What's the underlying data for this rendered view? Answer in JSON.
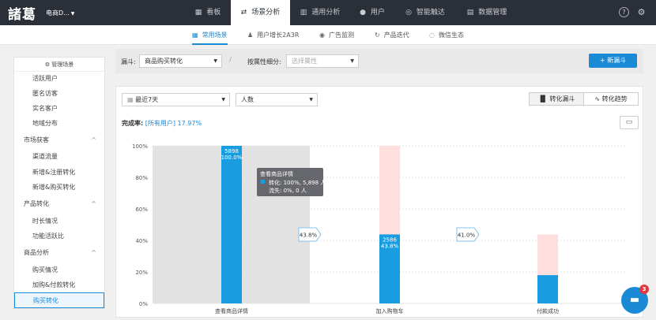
{
  "app": {
    "logo": "諸葛",
    "project": "电商D...",
    "help_icon": "?",
    "settings_icon": "settings"
  },
  "nav": {
    "items": [
      {
        "label": "看板",
        "icon": "▦"
      },
      {
        "label": "场景分析",
        "icon": "⇄"
      },
      {
        "label": "通用分析",
        "icon": "▥"
      },
      {
        "label": "用户",
        "icon": "●"
      },
      {
        "label": "智能触达",
        "icon": "◎"
      },
      {
        "label": "数据管理",
        "icon": "▤"
      }
    ]
  },
  "subnav": {
    "items": [
      {
        "label": "常用场景",
        "icon": "▦"
      },
      {
        "label": "用户增长2A3R",
        "icon": "♟"
      },
      {
        "label": "广告监测",
        "icon": "◉"
      },
      {
        "label": "产品迭代",
        "icon": "↻"
      },
      {
        "label": "微信生态",
        "icon": "◌"
      }
    ]
  },
  "sidebar": {
    "header": "管理场景",
    "top_items": [
      "活跃用户",
      "匿名访客",
      "实名客户",
      "地域分布"
    ],
    "groups": [
      {
        "label": "市场获客",
        "items": [
          "渠道流量",
          "新增&注册转化",
          "新增&购买转化"
        ]
      },
      {
        "label": "产品转化",
        "items": [
          "时长情况",
          "功能活跃比"
        ]
      },
      {
        "label": "商品分析",
        "items": [
          "购买情况",
          "加购&付款转化",
          "购买转化"
        ]
      }
    ]
  },
  "filter": {
    "funnel_label": "漏斗:",
    "funnel_value": "商品购买转化",
    "split_label": "按属性细分:",
    "split_placeholder": "选择属性",
    "new_button": "+ 新漏斗"
  },
  "panel": {
    "date_value": "最近7天",
    "metric_value": "人数",
    "tab_funnel": "转化漏斗",
    "tab_trend": "转化趋势",
    "rate_label": "完成率:",
    "rate_segment": "[所有用户]",
    "rate_value": "17.97%"
  },
  "chart_data": {
    "type": "bar",
    "categories": [
      "查看商品详情",
      "加入购物车",
      "付款成功"
    ],
    "yticks": [
      "100%",
      "80%",
      "60%",
      "40%",
      "20%",
      "0%"
    ],
    "ylim": [
      0,
      100
    ],
    "values": [
      100.0,
      43.8,
      17.97
    ],
    "counts": [
      "5898",
      "2586",
      ""
    ],
    "bar_labels": [
      "5898\n100.0%",
      "2586\n43.8%",
      ""
    ],
    "step_conversion": [
      "43.8%",
      "41.0%"
    ],
    "lost_top": [
      100,
      100,
      43.8
    ],
    "tooltip": {
      "title": "查看商品详情",
      "conv": "转化: 100%, 5,898 人",
      "lost": "流失: 0%, 0 人"
    },
    "colors": {
      "bar": "#1a9de0",
      "lost": "#ffdede",
      "hover": "#e2e2e2",
      "grid": "#e6e6e6"
    }
  },
  "chat": {
    "badge": "3"
  }
}
